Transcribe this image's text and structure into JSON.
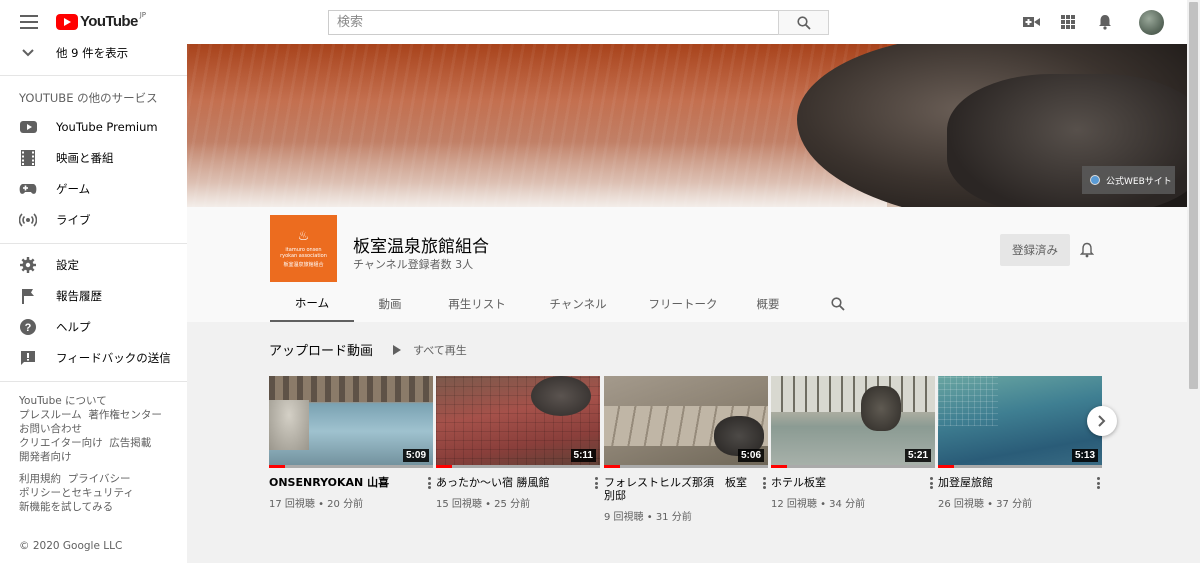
{
  "topbar": {
    "logo_text": "YouTube",
    "logo_region": "JP",
    "search_placeholder": "検索"
  },
  "sidebar": {
    "show_more": "他 9 件を表示",
    "services_heading": "YOUTUBE の他のサービス",
    "services": [
      {
        "label": "YouTube Premium",
        "icon": "youtube-premium-icon"
      },
      {
        "label": "映画と番組",
        "icon": "film-icon"
      },
      {
        "label": "ゲーム",
        "icon": "gamepad-icon"
      },
      {
        "label": "ライブ",
        "icon": "live-icon"
      }
    ],
    "settings": [
      {
        "label": "設定",
        "icon": "gear-icon"
      },
      {
        "label": "報告履歴",
        "icon": "flag-icon"
      },
      {
        "label": "ヘルプ",
        "icon": "help-icon"
      },
      {
        "label": "フィードバックの送信",
        "icon": "feedback-icon"
      }
    ],
    "footer_links_1": [
      "YouTube について",
      "プレスルーム",
      "著作権センター",
      "お問い合わせ",
      "クリエイター向け",
      "広告掲載",
      "開発者向け"
    ],
    "footer_links_2": [
      "利用規約",
      "プライバシー",
      "ポリシーとセキュリティ",
      "新機能を試してみる"
    ],
    "copyright": "© 2020 Google LLC"
  },
  "banner": {
    "web_link_label": "公式WEBサイト"
  },
  "channel": {
    "name": "板室温泉旅館組合",
    "subscribers": "チャンネル登録者数 3人",
    "avatar_text_1": "itamuro onsen",
    "avatar_text_2": "ryokan association",
    "avatar_text_3": "板室温泉旅館組合",
    "subscribed_label": "登録済み",
    "tabs": [
      "ホーム",
      "動画",
      "再生リスト",
      "チャンネル",
      "フリートーク",
      "概要"
    ]
  },
  "uploads": {
    "section_title": "アップロード動画",
    "play_all": "すべて再生",
    "videos": [
      {
        "title": "ONSENRYOKAN 山喜",
        "views": "17 回視聴",
        "age": "20 分前",
        "duration": "5:09",
        "watched": 0.1
      },
      {
        "title": "あったか〜い宿 勝風館",
        "views": "15 回視聴",
        "age": "25 分前",
        "duration": "5:11",
        "watched": 0.1
      },
      {
        "title_line1": "フォレストヒルズ那須　板室",
        "title_line2": "別邸",
        "views": "9 回視聴",
        "age": "31 分前",
        "duration": "5:06",
        "watched": 0.1
      },
      {
        "title": "ホテル板室",
        "views": "12 回視聴",
        "age": "34 分前",
        "duration": "5:21",
        "watched": 0.1
      },
      {
        "title": "加登屋旅館",
        "views": "26 回視聴",
        "age": "37 分前",
        "duration": "5:13",
        "watched": 0.1
      }
    ]
  }
}
